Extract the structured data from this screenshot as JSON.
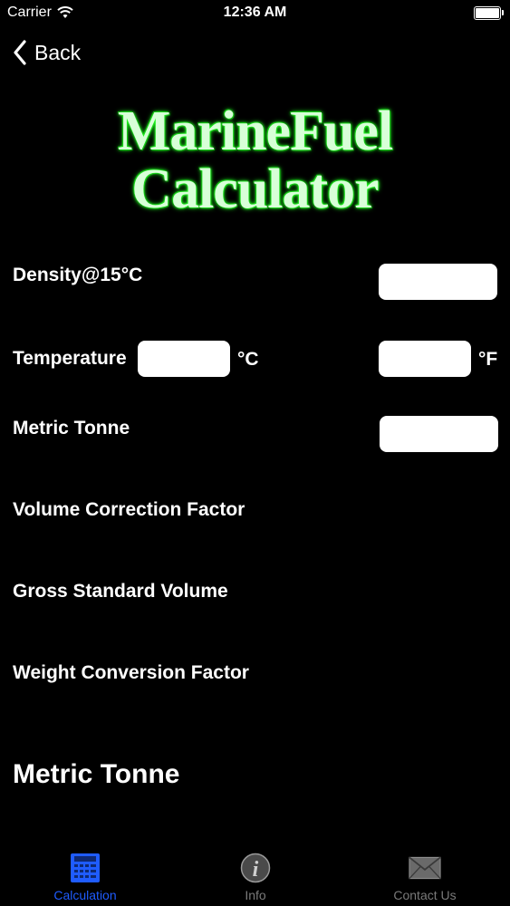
{
  "status_bar": {
    "carrier": "Carrier",
    "time": "12:36 AM"
  },
  "nav": {
    "back_label": "Back"
  },
  "logo": {
    "line1": "MarineFuel",
    "line2": "Calculator"
  },
  "form": {
    "density_label": "Density@15°C",
    "temperature_label": "Temperature",
    "celsius_unit": "°C",
    "fahrenheit_unit": "°F",
    "metric_tonne_label": "Metric Tonne",
    "vcf_label": "Volume Correction Factor",
    "gsv_label": "Gross Standard Volume",
    "wcf_label": "Weight Conversion Factor",
    "density_value": "",
    "temp_c_value": "",
    "temp_f_value": "",
    "metric_tonne_value": ""
  },
  "result": {
    "title": "Metric Tonne"
  },
  "tabs": [
    {
      "label": "Calculation",
      "icon": "calculator-icon",
      "active": true
    },
    {
      "label": "Info",
      "icon": "info-icon",
      "active": false
    },
    {
      "label": "Contact Us",
      "icon": "envelope-icon",
      "active": false
    }
  ],
  "colors": {
    "active_tab": "#1f5cff",
    "inactive_tab": "#7a7a7a",
    "logo_glow": "#22ff22"
  }
}
